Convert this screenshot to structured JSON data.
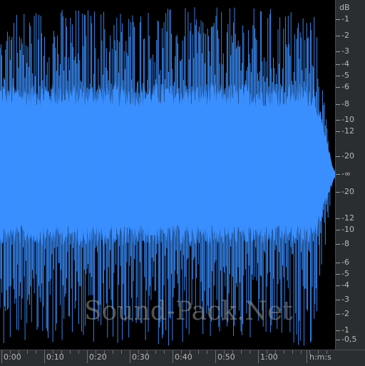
{
  "waveform": {
    "color": "#3a8fff",
    "background": "#000000",
    "peak_color": "#5aa2ff"
  },
  "db_scale": {
    "unit": "dB",
    "ticks": [
      "-1",
      "-2",
      "-3",
      "-4",
      "-5",
      "-6",
      "-8",
      "-10",
      "-12",
      "-20",
      "-∞",
      "-20",
      "-12",
      "-10",
      "-8",
      "-6",
      "-5",
      "-4",
      "-3",
      "-2",
      "-1",
      "-0,5"
    ]
  },
  "time_ruler": {
    "unit": "h:m:s",
    "labels": [
      "0:00",
      "0:10",
      "0:20",
      "0:30",
      "0:40",
      "0:50",
      "1:00"
    ]
  },
  "watermark": {
    "text": "Sound-Pack.Net"
  }
}
